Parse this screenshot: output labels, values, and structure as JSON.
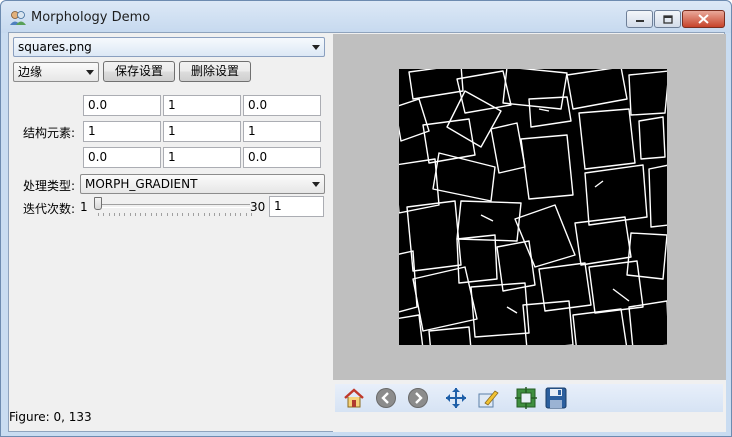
{
  "window": {
    "title": "Morphology Demo"
  },
  "controls": {
    "image_combo": "squares.png",
    "preset_combo": "边缘",
    "save_button": "保存设置",
    "delete_button": "删除设置",
    "kernel_label": "结构元素:",
    "kernel": [
      [
        "0.0",
        "1",
        "0.0"
      ],
      [
        "1",
        "1",
        "1"
      ],
      [
        "0.0",
        "1",
        "0.0"
      ]
    ],
    "process_label": "处理类型:",
    "process_combo": "MORPH_GRADIENT",
    "iter_label": "迭代次数:",
    "iter_min": "1",
    "iter_max": "30",
    "iter_value": "1",
    "iter_level": 0
  },
  "status": {
    "figure": "Figure: 0, 133"
  },
  "toolbar": {
    "icons": [
      "home-icon",
      "back-icon",
      "forward-icon",
      "pan-icon",
      "edit-axes-icon",
      "configure-subplots-icon",
      "save-icon"
    ]
  },
  "colors": {
    "accent": "#3c7fb1",
    "plot_bg": "#000000",
    "figure_bg": "#bfbfbf"
  }
}
